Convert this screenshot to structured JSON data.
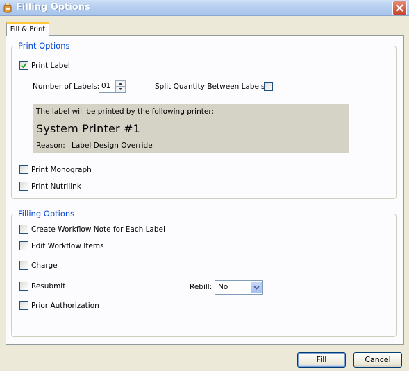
{
  "window": {
    "title": "Filling Options",
    "icon": "app-icon"
  },
  "tabs": [
    {
      "label": "Fill & Print",
      "active": true
    }
  ],
  "print_options": {
    "legend": "Print Options",
    "print_label": {
      "label": "Print Label",
      "checked": true
    },
    "number_of_labels": {
      "label": "Number of Labels:",
      "value": "01"
    },
    "split_quantity": {
      "label": "Split Quantity Between Labels:",
      "checked": false
    },
    "printer_info": {
      "intro": "The label will be printed by the following printer:",
      "printer_name": "System Printer #1",
      "reason_label": "Reason:",
      "reason_value": "Label Design Override"
    },
    "print_monograph": {
      "label": "Print Monograph",
      "checked": false
    },
    "print_nutrilink": {
      "label": "Print Nutrilink",
      "checked": false
    }
  },
  "filling_options": {
    "legend": "Filling Options",
    "create_workflow_note": {
      "label": "Create Workflow Note for Each Label",
      "checked": false
    },
    "edit_workflow_items": {
      "label": "Edit Workflow Items",
      "checked": false
    },
    "charge": {
      "label": "Charge",
      "checked": false
    },
    "resubmit": {
      "label": "Resubmit",
      "checked": false
    },
    "prior_authorization": {
      "label": "Prior Authorization",
      "checked": false
    },
    "rebill": {
      "label": "Rebill:",
      "value": "No"
    }
  },
  "buttons": {
    "fill": "Fill",
    "cancel": "Cancel"
  },
  "colors": {
    "accent": "#0046d5",
    "title_bar": "#b8d0f1",
    "close": "#c8452a",
    "printer_box": "#d5d2c6"
  }
}
